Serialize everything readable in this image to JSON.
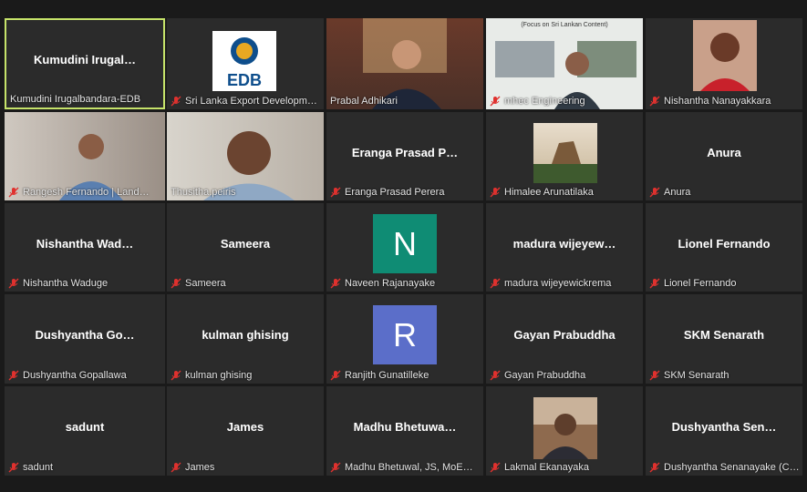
{
  "participants": [
    {
      "label": "Kumudini Irugalbandara-EDB",
      "center": "Kumudini  Irugal…",
      "active": true
    },
    {
      "label": "Sri Lanka Export Developm…",
      "logo": "EDB"
    },
    {
      "label": "Prabal Adhikari"
    },
    {
      "label": "mhec Engineering",
      "image_caption": "(Focus on Sri Lankan Content)"
    },
    {
      "label": "Nishantha Nanayakkara"
    },
    {
      "label": "Rangesh Fernando | Land…"
    },
    {
      "label": "Thusitha.peiris"
    },
    {
      "label": "Eranga Prasad Perera",
      "center": "Eranga  Prasad  P…"
    },
    {
      "label": "Himalee Arunatilaka"
    },
    {
      "label": "Anura",
      "center": "Anura"
    },
    {
      "label": "Nishantha Waduge",
      "center": "Nishantha  Wad…"
    },
    {
      "label": "Sameera",
      "center": "Sameera"
    },
    {
      "label": "Naveen Rajanayake",
      "avatar": "N",
      "avatar_color": "#0f8c74"
    },
    {
      "label": "madura wijeyewickrema",
      "center": "madura  wijeyew…"
    },
    {
      "label": "Lionel Fernando",
      "center": "Lionel Fernando"
    },
    {
      "label": "Dushyantha Gopallawa",
      "center": "Dushyantha  Go…"
    },
    {
      "label": "kulman ghising",
      "center": "kulman ghising"
    },
    {
      "label": "Ranjith Gunatilleke",
      "avatar": "R",
      "avatar_color": "#5b6ec9"
    },
    {
      "label": "Gayan Prabuddha",
      "center": "Gayan Prabuddha"
    },
    {
      "label": "SKM Senarath",
      "center": "SKM Senarath"
    },
    {
      "label": "sadunt",
      "center": "sadunt"
    },
    {
      "label": "James",
      "center": "James"
    },
    {
      "label": "Madhu Bhetuwal, JS, MoE…",
      "center": "Madhu  Bhetuwa…"
    },
    {
      "label": "Lakmal Ekanayaka"
    },
    {
      "label": "Dushyantha Senanayake (C…",
      "center": "Dushyantha  Sen…"
    }
  ],
  "colors": {
    "active_border": "#c6e36a",
    "mic_muted": "#e0312e",
    "tile_bg": "#2b2b2b"
  },
  "icons": {
    "mic": "mic-muted-icon"
  }
}
